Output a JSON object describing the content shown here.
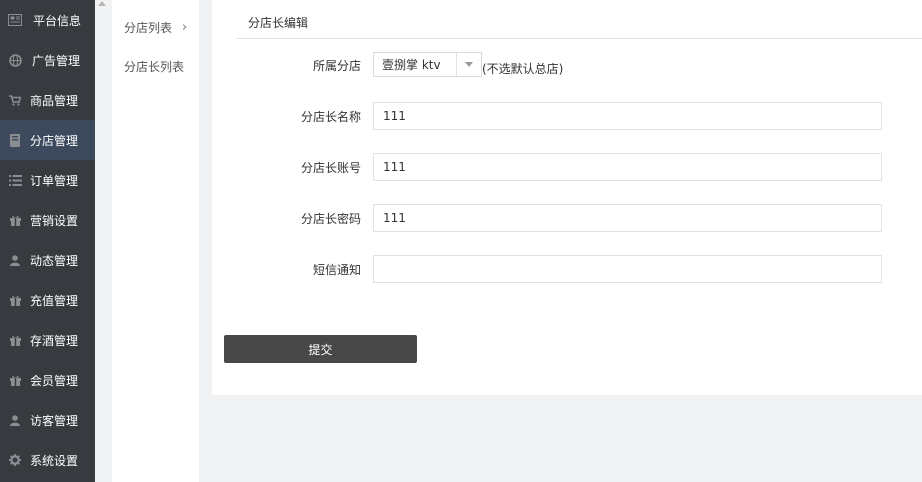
{
  "sidebar": {
    "items": [
      {
        "label": "平台信息",
        "icon": "newspaper-icon"
      },
      {
        "label": "广告管理",
        "icon": "globe-icon"
      },
      {
        "label": "商品管理",
        "icon": "cart-icon"
      },
      {
        "label": "分店管理",
        "icon": "book-icon"
      },
      {
        "label": "订单管理",
        "icon": "list-icon"
      },
      {
        "label": "营销设置",
        "icon": "gift-icon"
      },
      {
        "label": "动态管理",
        "icon": "user-icon"
      },
      {
        "label": "充值管理",
        "icon": "gift-icon"
      },
      {
        "label": "存酒管理",
        "icon": "gift-icon"
      },
      {
        "label": "会员管理",
        "icon": "gift-icon"
      },
      {
        "label": "访客管理",
        "icon": "user-icon"
      },
      {
        "label": "系统设置",
        "icon": "gear-icon"
      }
    ],
    "active_index": 3
  },
  "submenu": {
    "items": [
      {
        "label": "分店列表",
        "chevron": "›"
      },
      {
        "label": "分店长列表"
      }
    ]
  },
  "form": {
    "title": "分店长编辑",
    "store_label": "所属分店",
    "store_selected": "壹捌掌 ktv",
    "store_hint": "(不选默认总店)",
    "name_label": "分店长名称",
    "name_value": "111",
    "account_label": "分店长账号",
    "account_value": "111",
    "password_label": "分店长密码",
    "password_value": "111",
    "sms_label": "短信通知",
    "sms_value": "",
    "submit_label": "提交"
  },
  "colors": {
    "sidebar_bg": "#373a3e",
    "sidebar_active": "#3d4a5e",
    "submit_bg": "#484848",
    "page_bg": "#f1f2f4"
  }
}
